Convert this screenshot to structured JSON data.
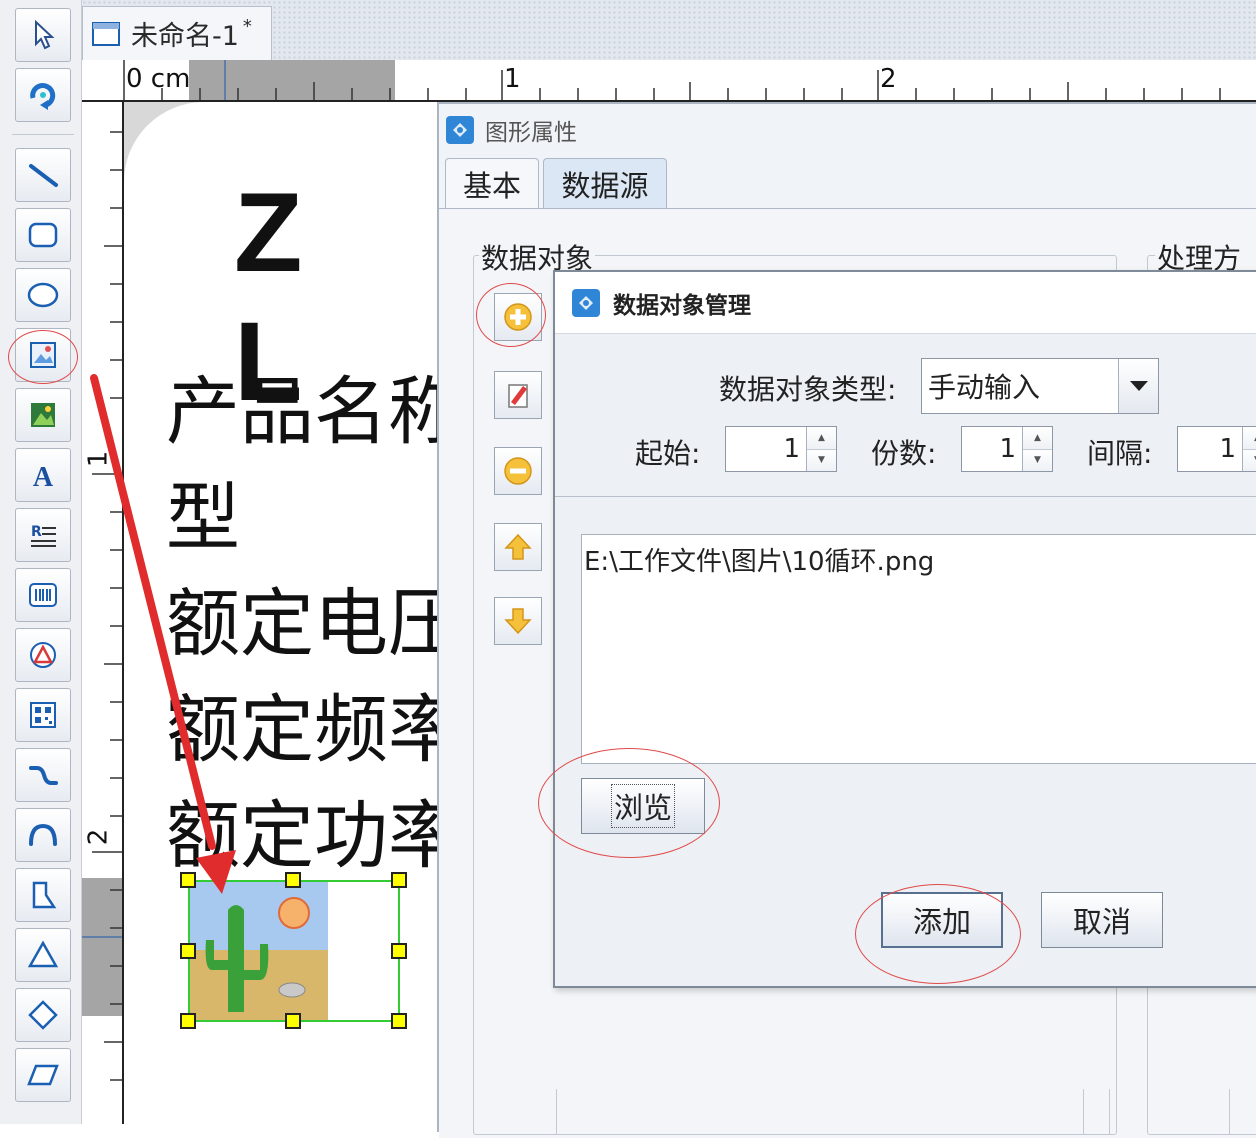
{
  "document": {
    "title": "未命名-1",
    "modified_marker": "*"
  },
  "ruler": {
    "horizontal_labels": [
      "0 cm",
      "1",
      "2"
    ],
    "vertical_labels": [
      "1",
      "2"
    ]
  },
  "toolbar": {
    "tools": [
      {
        "name": "select-tool",
        "icon": "arrow-pointer-icon"
      },
      {
        "name": "rotate-tool",
        "icon": "rotate-icon"
      },
      {
        "name": "line-tool",
        "icon": "line-icon"
      },
      {
        "name": "rounded-rect-tool",
        "icon": "rounded-rect-icon"
      },
      {
        "name": "ellipse-tool",
        "icon": "ellipse-icon"
      },
      {
        "name": "image-tool",
        "icon": "image-icon"
      },
      {
        "name": "picture-tool",
        "icon": "picture-icon"
      },
      {
        "name": "text-tool",
        "icon": "text-a-icon"
      },
      {
        "name": "rich-text-tool",
        "icon": "rich-text-icon"
      },
      {
        "name": "barcode-tool",
        "icon": "barcode-icon"
      },
      {
        "name": "shape-tool",
        "icon": "shapes-icon"
      },
      {
        "name": "qrcode-tool",
        "icon": "qrcode-icon"
      },
      {
        "name": "curve-tool",
        "icon": "curve-icon"
      },
      {
        "name": "arc-tool",
        "icon": "arc-icon"
      },
      {
        "name": "polyline-tool",
        "icon": "polyline-icon"
      },
      {
        "name": "triangle-tool",
        "icon": "triangle-icon"
      },
      {
        "name": "diamond-tool",
        "icon": "diamond-icon"
      },
      {
        "name": "parallelogram-tool",
        "icon": "parallelogram-icon"
      }
    ]
  },
  "label_page": {
    "heading": "Z L",
    "lines": [
      "产品名称",
      "型　　　号",
      "额定电压",
      "额定频率",
      "额定功率"
    ]
  },
  "properties_window": {
    "title": "图形属性",
    "tabs": [
      {
        "label": "基本",
        "active": false
      },
      {
        "label": "数据源",
        "active": true
      }
    ],
    "data_object_group": "数据对象",
    "processing_group": "处理方法",
    "side_buttons": [
      "add-icon",
      "edit-icon",
      "remove-icon",
      "move-up-icon",
      "move-down-icon"
    ]
  },
  "data_object_dialog": {
    "title": "数据对象管理",
    "type_label": "数据对象类型:",
    "type_value": "手动输入",
    "start_label": "起始:",
    "start_value": "1",
    "count_label": "份数:",
    "count_value": "1",
    "interval_label": "间隔:",
    "interval_value": "1",
    "content": "E:\\工作文件\\图片\\10循环.png",
    "browse_label": "浏览",
    "add_label": "添加",
    "cancel_label": "取消"
  },
  "colors": {
    "annotation_red": "#e02c2c",
    "selection_green": "#33cc33",
    "handle_yellow": "#ffff00"
  }
}
